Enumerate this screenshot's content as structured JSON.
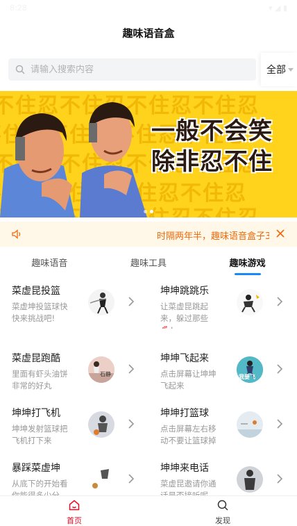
{
  "status_bar": {
    "time": "8:28",
    "icons": "▾ ◢ ▮"
  },
  "header": {
    "title": "趣味语音盒"
  },
  "search": {
    "placeholder": "请输入搜索内容",
    "filter_label": "全部"
  },
  "banner": {
    "line1": "一般不会笑",
    "line2": "除非忍不住",
    "bg_pattern": "不住忍不住忍不住忍不住忍",
    "slides": 2,
    "active_slide": 2
  },
  "notice": {
    "text": "时隔两年半，趣味语音盒子3"
  },
  "tabs": [
    {
      "label": "趣味语音",
      "active": false
    },
    {
      "label": "趣味工具",
      "active": false
    },
    {
      "label": "趣味游戏",
      "active": true
    }
  ],
  "games": [
    {
      "title": "菜虚昆投篮",
      "desc": "菜虚坤投篮球快快来挑战吧!"
    },
    {
      "title": "坤坤跳跳乐",
      "desc": "让菜虚昆跳起来，躲过那些🐔!"
    },
    {
      "title": "菜虚昆跑酷",
      "desc": "里面有虾头油饼非常的好丸"
    },
    {
      "title": "坤坤飞起来",
      "desc": "点击屏幕让坤坤飞起来"
    },
    {
      "title": "坤坤打飞机",
      "desc": "坤坤发射篮球把飞机打下来"
    },
    {
      "title": "坤坤打篮球",
      "desc": "点击屏幕左右移动不要让篮球掉"
    },
    {
      "title": "暴踩菜虚坤",
      "desc": "从底下的开始看你能得多少分"
    },
    {
      "title": "坤坤来电话",
      "desc": "菜虚昆邀请你通话是否接听呢"
    }
  ],
  "thumb_texts": {
    "run": "石静",
    "fly": "我要飞"
  },
  "bottom_nav": [
    {
      "label": "首页",
      "icon": "home-icon",
      "active": true
    },
    {
      "label": "发现",
      "icon": "search-icon",
      "active": false
    }
  ],
  "colors": {
    "accent": "#ee0a24",
    "tab_indicator": "#1989fa",
    "notice_text": "#ed6a0c",
    "notice_bg": "#fff7e8",
    "banner_bg": "#ffd21c"
  }
}
